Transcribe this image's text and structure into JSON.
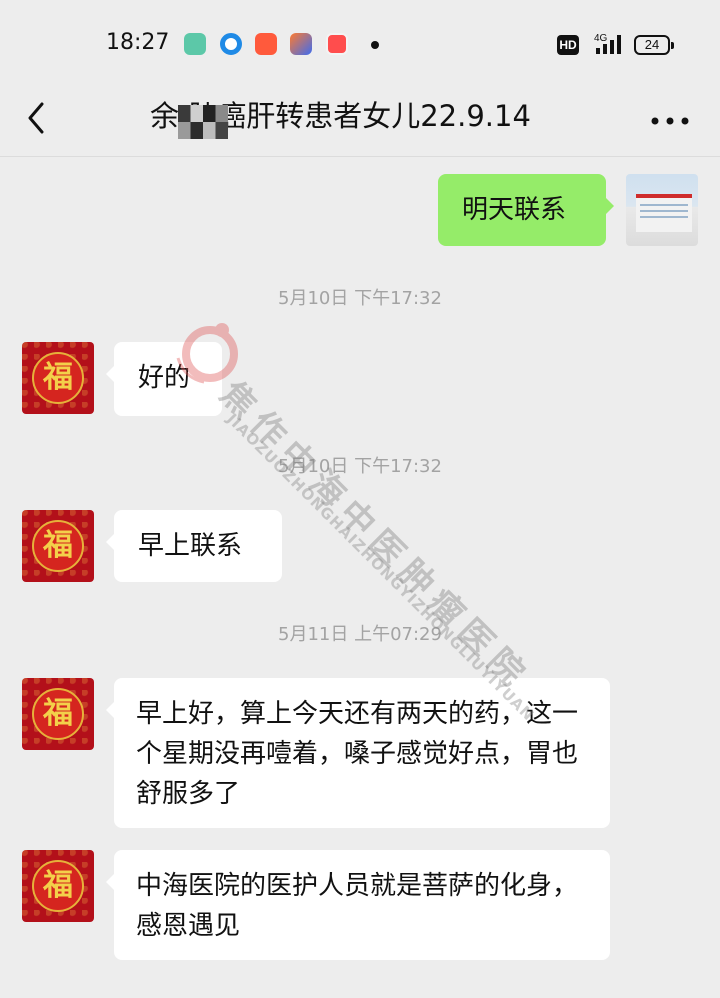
{
  "status_bar": {
    "time": "18:27",
    "hd_badge": "HD",
    "network": "4G",
    "battery": "24"
  },
  "nav": {
    "title": "余     肺癌肝转患者女儿22.9.14",
    "back_icon": "chevron-left-icon",
    "more_icon": "more-dots-icon"
  },
  "messages": [
    {
      "from": "me",
      "text": "明天联系"
    },
    {
      "timestamp": "5月10日 下午17:32"
    },
    {
      "from": "contact",
      "text": "好的"
    },
    {
      "timestamp": "5月10日 下午17:32"
    },
    {
      "from": "contact",
      "text": "早上联系"
    },
    {
      "timestamp": "5月11日 上午07:29"
    },
    {
      "from": "contact",
      "text": "早上好，算上今天还有两天的药，这一个星期没再噎着，嗓子感觉好点，胃也舒服多了"
    },
    {
      "from": "contact",
      "text": "中海医院的医护人员就是菩萨的化身，感恩遇见"
    }
  ],
  "contact_avatar_text": "福",
  "watermark": {
    "cn": "焦作中海中医肿瘤医院",
    "en": "JIAOZUOZHONGHAIZHONGYIZHONGLIUYIYUAN"
  },
  "colors": {
    "background": "#ededed",
    "my_bubble": "#95ec69",
    "their_bubble": "#ffffff",
    "timestamp": "#a3a3a3"
  }
}
